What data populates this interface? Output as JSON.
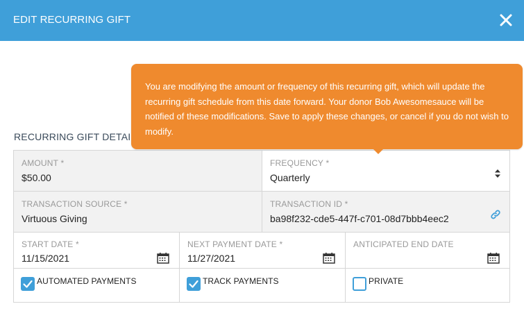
{
  "modal": {
    "title": "EDIT RECURRING GIFT",
    "close_icon": "close-icon"
  },
  "tooltip": {
    "text": "You are modifying the amount or frequency of this recurring gift, which will update the recurring gift schedule from this date forward. Your donor Bob Awesomesauce will be notified of these modifications. Save to apply these changes, or cancel if you do not wish to modify."
  },
  "section": {
    "title": "RECURRING GIFT DETAILS"
  },
  "fields": {
    "amount": {
      "label": "AMOUNT *",
      "value": "$50.00"
    },
    "frequency": {
      "label": "FREQUENCY *",
      "value": "Quarterly",
      "icon": "sort-icon"
    },
    "transaction_source": {
      "label": "TRANSACTION SOURCE *",
      "value": "Virtuous Giving"
    },
    "transaction_id": {
      "label": "TRANSACTION ID *",
      "value": "ba98f232-cde5-447f-c701-08d7bbb4eec2",
      "icon": "link-icon"
    },
    "start_date": {
      "label": "START DATE *",
      "value": "11/15/2021",
      "icon": "calendar-icon"
    },
    "next_payment_date": {
      "label": "NEXT PAYMENT DATE *",
      "value": "11/27/2021",
      "icon": "calendar-icon"
    },
    "anticipated_end_date": {
      "label": "ANTICIPATED END DATE",
      "value": "",
      "icon": "calendar-icon"
    }
  },
  "checkboxes": {
    "automated_payments": {
      "label": "AUTOMATED PAYMENTS",
      "checked": true
    },
    "track_payments": {
      "label": "TRACK PAYMENTS",
      "checked": true
    },
    "private": {
      "label": "PRIVATE",
      "checked": false
    }
  },
  "colors": {
    "header": "#3f9fd9",
    "tooltip": "#ef8a2e",
    "readonly_cell": "#f2f2f2",
    "checkbox": "#3f9fd9"
  }
}
